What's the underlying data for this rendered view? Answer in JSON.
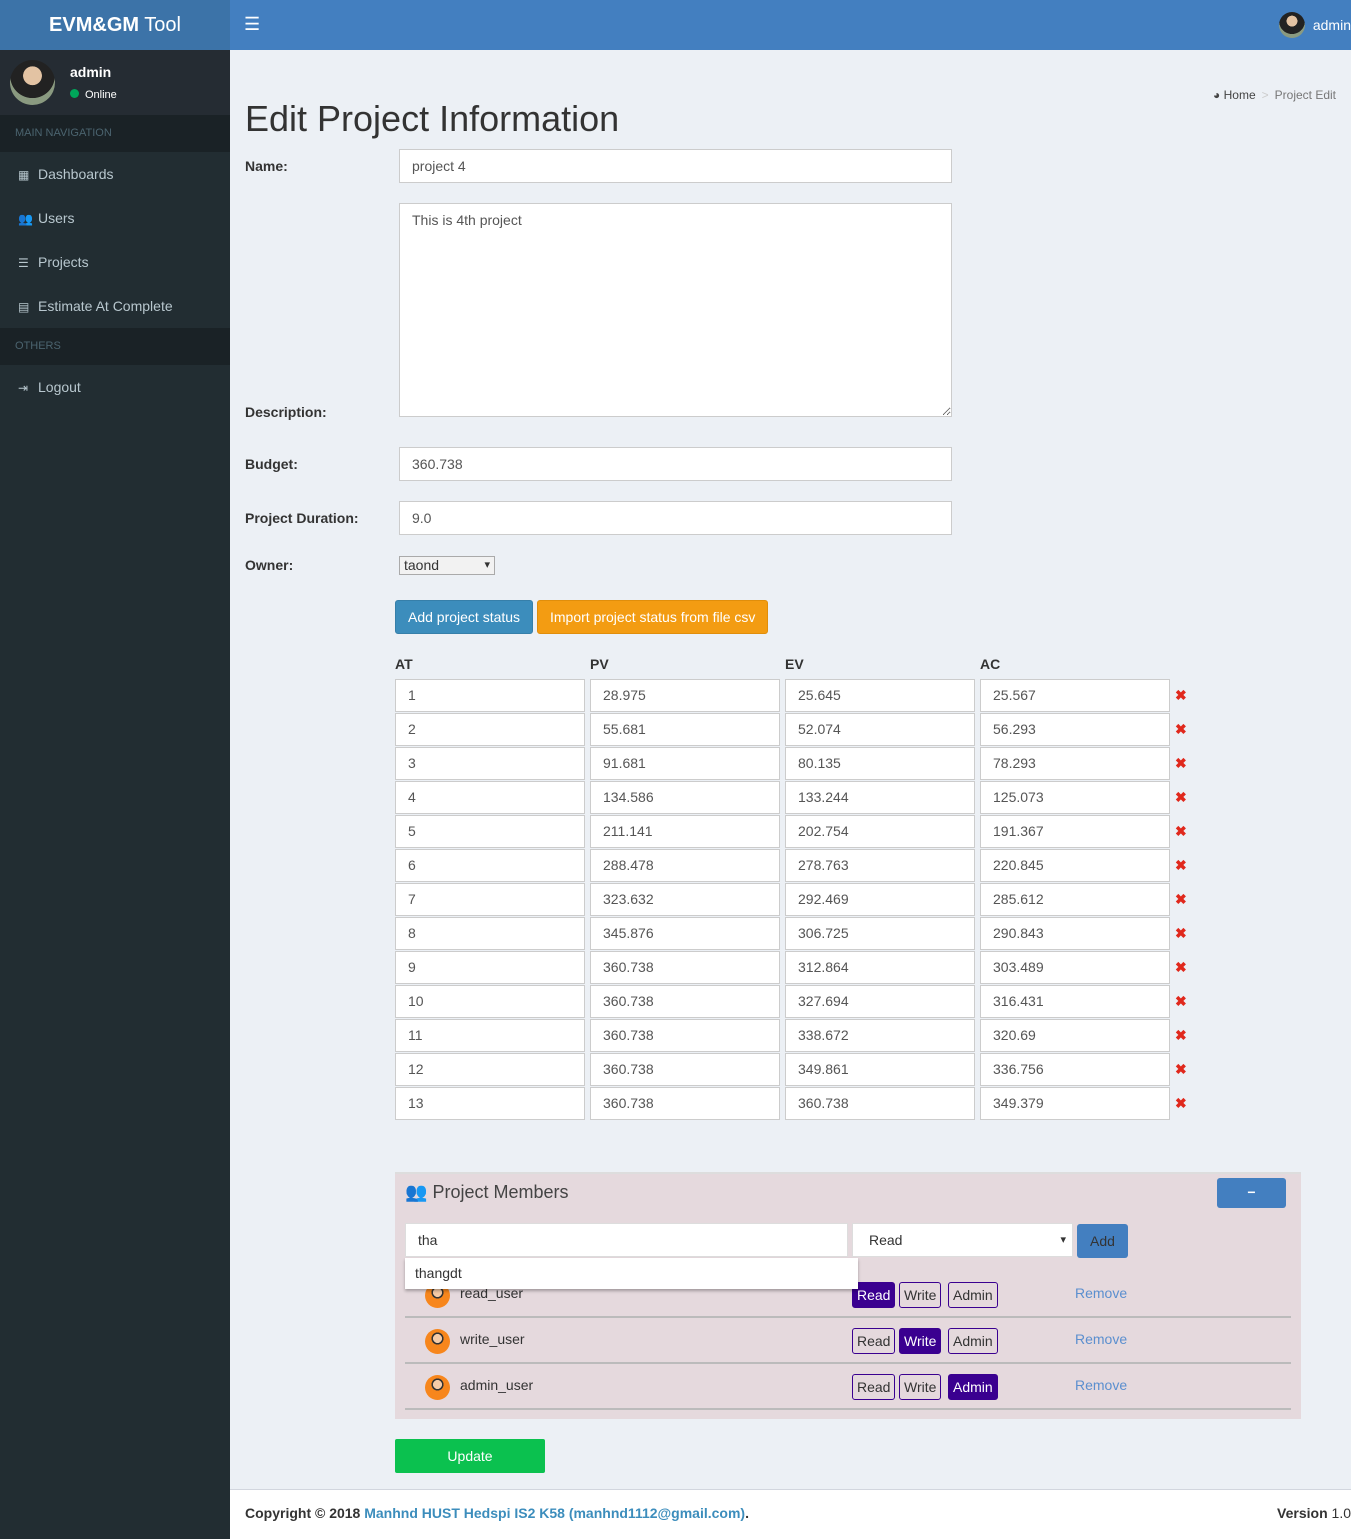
{
  "app": {
    "logo_bold": "EVM&GM",
    "logo_light": "Tool",
    "user": "admin",
    "status": "Online"
  },
  "sidebar": {
    "main_header": "MAIN NAVIGATION",
    "items": [
      {
        "label": "Dashboards",
        "icon": "grid-icon"
      },
      {
        "label": "Users",
        "icon": "users-icon"
      },
      {
        "label": "Projects",
        "icon": "list-icon"
      },
      {
        "label": "Estimate At Complete",
        "icon": "calculator-icon"
      }
    ],
    "others_header": "OTHERS",
    "logout": "Logout"
  },
  "breadcrumb": {
    "home": "Home",
    "sep": ">",
    "current": "Project Edit"
  },
  "page": {
    "title": "Edit Project Information"
  },
  "form": {
    "name_label": "Name:",
    "name": "project 4",
    "description_label": "Description:",
    "description": "This is 4th project",
    "budget_label": "Budget:",
    "budget": "360.738",
    "duration_label": "Project Duration:",
    "duration": "9.0",
    "owner_label": "Owner:",
    "owner": "taond"
  },
  "buttons": {
    "add_status": "Add project status",
    "import_status": "Import project status from file csv",
    "update": "Update"
  },
  "status_table": {
    "headers": [
      "AT",
      "PV",
      "EV",
      "AC"
    ],
    "rows": [
      [
        "1",
        "28.975",
        "25.645",
        "25.567"
      ],
      [
        "2",
        "55.681",
        "52.074",
        "56.293"
      ],
      [
        "3",
        "91.681",
        "80.135",
        "78.293"
      ],
      [
        "4",
        "134.586",
        "133.244",
        "125.073"
      ],
      [
        "5",
        "211.141",
        "202.754",
        "191.367"
      ],
      [
        "6",
        "288.478",
        "278.763",
        "220.845"
      ],
      [
        "7",
        "323.632",
        "292.469",
        "285.612"
      ],
      [
        "8",
        "345.876",
        "306.725",
        "290.843"
      ],
      [
        "9",
        "360.738",
        "312.864",
        "303.489"
      ],
      [
        "10",
        "360.738",
        "327.694",
        "316.431"
      ],
      [
        "11",
        "360.738",
        "338.672",
        "320.69"
      ],
      [
        "12",
        "360.738",
        "349.861",
        "336.756"
      ],
      [
        "13",
        "360.738",
        "360.738",
        "349.379"
      ]
    ],
    "delete_glyph": "✖"
  },
  "members": {
    "title": "Project Members",
    "collapse": "−",
    "search": "tha",
    "role": "Read",
    "add": "Add",
    "suggestion": "thangdt",
    "roles": [
      "Read",
      "Write",
      "Admin"
    ],
    "remove": "Remove",
    "list": [
      {
        "name": "read_user",
        "role": "Read"
      },
      {
        "name": "write_user",
        "role": "Write"
      },
      {
        "name": "admin_user",
        "role": "Admin"
      }
    ]
  },
  "footer": {
    "copyright": "Copyright © 2018",
    "author": "Manhnd HUST Hedspi IS2 K58 (manhnd1112@gmail.com)",
    "dot": ".",
    "version_label": "Version",
    "version": "1.0"
  },
  "colors": {
    "header": "#437fc0",
    "sidebar": "#222d32",
    "accent_purple": "#3a0090",
    "update": "#0bc14f",
    "import": "#f39c12"
  }
}
